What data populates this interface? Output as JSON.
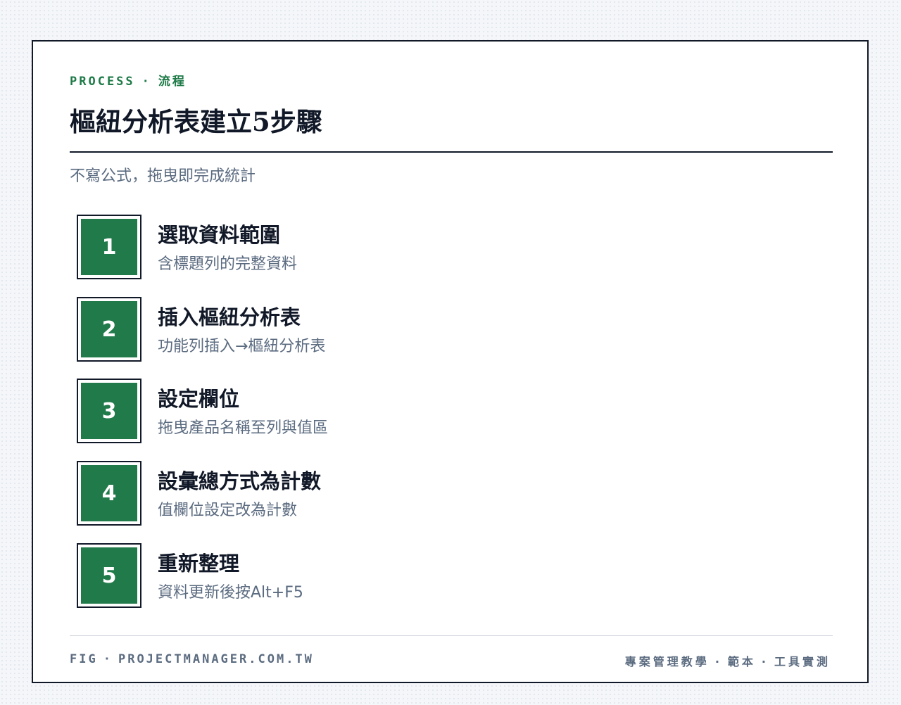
{
  "eyebrow": {
    "label": "PROCESS",
    "separator": "·",
    "category": "流程"
  },
  "title": "樞紐分析表建立5步驟",
  "subtitle": "不寫公式，拖曳即完成統計",
  "steps": [
    {
      "number": "1",
      "title": "選取資料範圍",
      "description": "含標題列的完整資料"
    },
    {
      "number": "2",
      "title": "插入樞紐分析表",
      "description": "功能列插入→樞紐分析表"
    },
    {
      "number": "3",
      "title": "設定欄位",
      "description": "拖曳產品名稱至列與值區"
    },
    {
      "number": "4",
      "title": "設彙總方式為計數",
      "description": "值欄位設定改為計數"
    },
    {
      "number": "5",
      "title": "重新整理",
      "description": "資料更新後按Alt+F5"
    }
  ],
  "footer": {
    "left_label": "FIG",
    "separator": "·",
    "site": "PROJECTMANAGER.COM.TW",
    "right_items": [
      "專案管理教學",
      "範本",
      "工具實測"
    ]
  },
  "colors": {
    "accent_green": "#217a49",
    "eyebrow_green": "#1e7a47",
    "ink": "#111827",
    "muted": "#5b6b80"
  }
}
